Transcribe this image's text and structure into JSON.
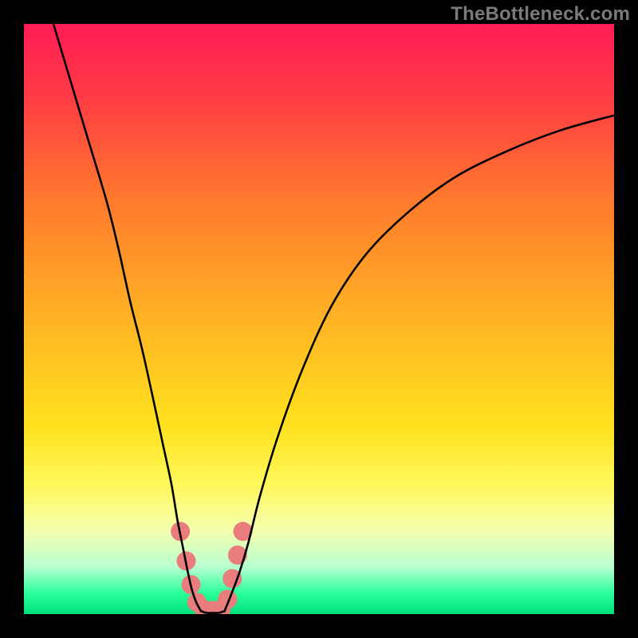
{
  "watermark": "TheBottleneck.com",
  "chart_data": {
    "type": "line",
    "title": "",
    "xlabel": "",
    "ylabel": "",
    "xlim": [
      0,
      100
    ],
    "ylim": [
      0,
      100
    ],
    "grid": false,
    "legend": false,
    "background_gradient_stops": [
      {
        "pos": 0.0,
        "color": "#ff1d55"
      },
      {
        "pos": 0.12,
        "color": "#ff3a45"
      },
      {
        "pos": 0.3,
        "color": "#ff7a2d"
      },
      {
        "pos": 0.5,
        "color": "#ffb324"
      },
      {
        "pos": 0.68,
        "color": "#ffe11e"
      },
      {
        "pos": 0.78,
        "color": "#fff85a"
      },
      {
        "pos": 0.86,
        "color": "#f3ffb0"
      },
      {
        "pos": 0.92,
        "color": "#b8ffd0"
      },
      {
        "pos": 0.965,
        "color": "#2bff9a"
      },
      {
        "pos": 1.0,
        "color": "#00e07a"
      }
    ],
    "series": [
      {
        "name": "left-curve",
        "color": "#000000",
        "x": [
          5,
          8,
          11,
          14,
          16,
          18,
          20,
          22,
          23.5,
          25,
          26,
          27,
          27.8,
          28.5,
          29.2,
          30
        ],
        "y": [
          100,
          90,
          80,
          70,
          62,
          53,
          45,
          36,
          29,
          22,
          16,
          11,
          7,
          4,
          2,
          0.5
        ]
      },
      {
        "name": "right-curve",
        "color": "#000000",
        "x": [
          34,
          35,
          36.5,
          38,
          40,
          43,
          47,
          52,
          58,
          65,
          73,
          82,
          91,
          100
        ],
        "y": [
          0.5,
          3,
          7,
          12,
          20,
          30,
          41,
          52,
          61,
          68,
          74,
          78.5,
          82,
          84.5
        ]
      },
      {
        "name": "valley-floor",
        "color": "#000000",
        "x": [
          30,
          31,
          32,
          33,
          34
        ],
        "y": [
          0.5,
          0.2,
          0.2,
          0.2,
          0.5
        ]
      }
    ],
    "markers": {
      "name": "highlight-dots",
      "color": "#e97c7c",
      "points": [
        {
          "x": 26.5,
          "y": 14
        },
        {
          "x": 27.5,
          "y": 9
        },
        {
          "x": 28.3,
          "y": 5
        },
        {
          "x": 29.3,
          "y": 2
        },
        {
          "x": 30.5,
          "y": 0.8
        },
        {
          "x": 32.0,
          "y": 0.6
        },
        {
          "x": 33.4,
          "y": 0.8
        },
        {
          "x": 34.5,
          "y": 2.5
        },
        {
          "x": 35.3,
          "y": 6
        },
        {
          "x": 36.2,
          "y": 10
        },
        {
          "x": 37.1,
          "y": 14
        }
      ]
    }
  }
}
